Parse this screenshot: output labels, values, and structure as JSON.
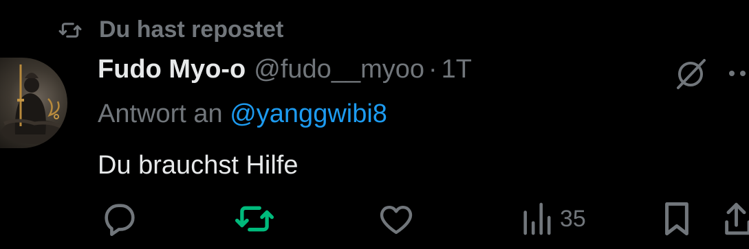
{
  "repost": {
    "label": "Du hast repostet",
    "icon": "repost-icon"
  },
  "author": {
    "name": "Fudo Myo-o",
    "handle": "@fudo__myoo",
    "separator": "·",
    "time": "1T",
    "avatar": "avatar-image"
  },
  "reply": {
    "prefix": "Antwort an",
    "mention": "@yanggwibi8"
  },
  "body": {
    "text": "Du brauchst Hilfe"
  },
  "actions": {
    "reply_icon": "reply-icon",
    "repost_icon": "repost-icon",
    "like_icon": "heart-icon",
    "views_icon": "views-icon",
    "views_count": "35",
    "bookmark_icon": "bookmark-icon",
    "share_icon": "share-icon"
  },
  "colors": {
    "background": "#000000",
    "text": "#e7e9ea",
    "muted": "#71767b",
    "link": "#1d9bf0",
    "reposted": "#00ba7c"
  }
}
